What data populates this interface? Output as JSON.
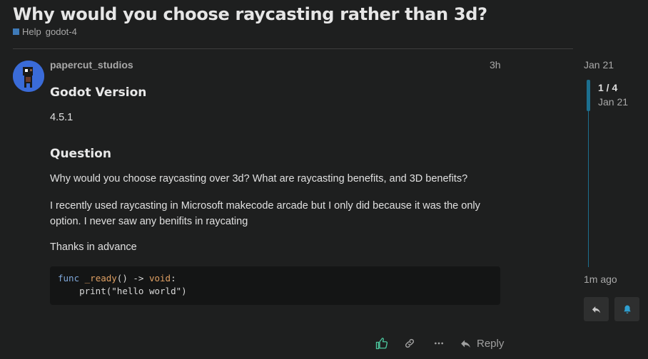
{
  "topic": {
    "title": "Why would you choose raycasting rather than 3d?",
    "category": "Help",
    "category_color": "#3e7ab8",
    "tag": "godot-4"
  },
  "post": {
    "username": "papercut_studios",
    "time": "3h",
    "heading1": "Godot Version",
    "version": "4.5.1",
    "heading2": "Question",
    "para1": "Why would you choose raycasting over 3d? What are raycasting benefits, and 3D benefits?",
    "para2_line1": "I recently used raycasting in Microsoft makecode arcade but I only did because it was the only",
    "para2_line2": "option. I never saw any benifits in raycating",
    "para3": "Thanks in advance",
    "code": {
      "l1_kw": "func",
      "l1_fn": "_ready",
      "l1_mid": "() -> ",
      "l1_ret": "void",
      "l1_end": ":",
      "l2_indent": "    ",
      "l2_fn": "print",
      "l2_open": "(",
      "l2_str": "\"hello world\"",
      "l2_close": ")"
    },
    "actions": {
      "like_icon": "thumbs-up-icon",
      "link_icon": "link-icon",
      "more_icon": "ellipsis-icon",
      "reply_icon": "reply-arrow-icon",
      "reply_label": "Reply"
    }
  },
  "timeline": {
    "start_date": "Jan 21",
    "position": "1 / 4",
    "position_date": "Jan 21",
    "end_label": "1m ago",
    "reply_button_icon": "reply-arrow-icon",
    "notify_button_icon": "bell-icon",
    "accent_color": "#1c6f8f"
  }
}
